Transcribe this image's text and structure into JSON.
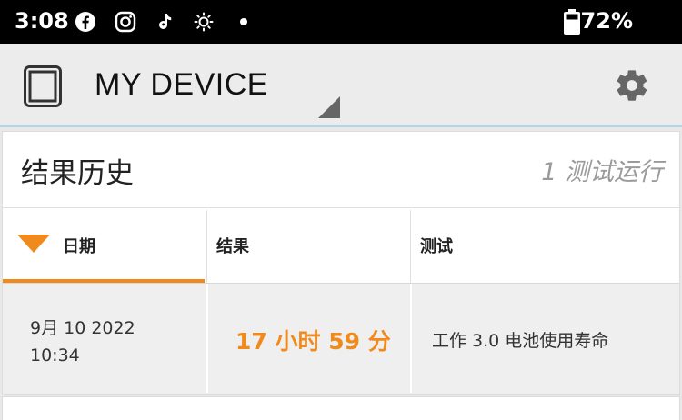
{
  "status_bar": {
    "time": "3:08",
    "battery": "72%",
    "icons": [
      "facebook-icon",
      "instagram-icon",
      "music-note-icon",
      "brightness-icon",
      "dot-icon",
      "battery-icon"
    ]
  },
  "app_bar": {
    "title": "MY DEVICE",
    "left_icon": "tablet-icon",
    "right_icon": "gear-icon",
    "accent": "#b8d4e4"
  },
  "results": {
    "title": "结果历史",
    "count": "1 测试运行",
    "columns": [
      "日期",
      "结果",
      "测试"
    ],
    "rows": [
      {
        "date_line1": "9月 10 2022",
        "date_line2": "10:34",
        "result": "17 小时 59 分",
        "test": "工作 3.0 电池使用寿命"
      }
    ],
    "accent": "#f08a1c"
  }
}
